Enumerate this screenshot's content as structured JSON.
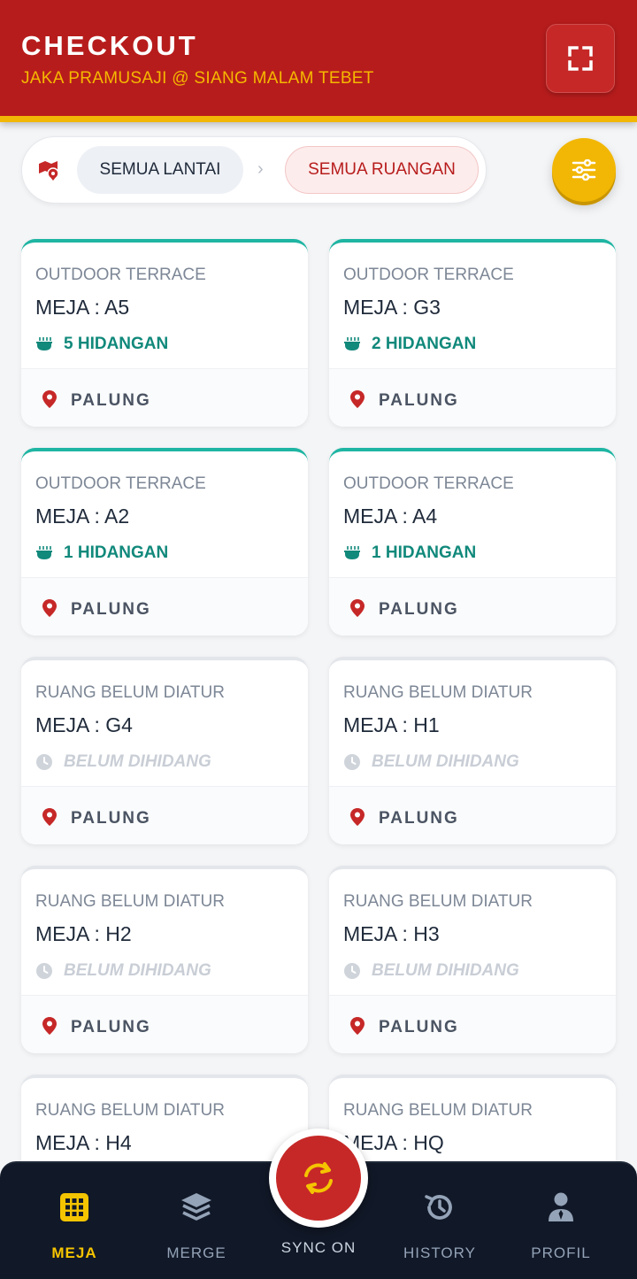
{
  "header": {
    "title": "CHECKOUT",
    "subtitle": "JAKA PRAMUSAJI @ SIANG MALAM  TEBET",
    "fullscreen_icon": "fullscreen-icon"
  },
  "filter": {
    "map_icon": "map-pin-icon",
    "floor_label": "SEMUA LANTAI",
    "separator": "›",
    "room_label": "SEMUA RUANGAN",
    "settings_icon": "sliders-icon"
  },
  "tables": [
    {
      "room": "OUTDOOR TERRACE",
      "table": "MEJA : A5",
      "status": "5 HIDANGAN",
      "served": true,
      "location": "PALUNG"
    },
    {
      "room": "OUTDOOR TERRACE",
      "table": "MEJA : G3",
      "status": "2 HIDANGAN",
      "served": true,
      "location": "PALUNG"
    },
    {
      "room": "OUTDOOR TERRACE",
      "table": "MEJA : A2",
      "status": "1 HIDANGAN",
      "served": true,
      "location": "PALUNG"
    },
    {
      "room": "OUTDOOR TERRACE",
      "table": "MEJA : A4",
      "status": "1 HIDANGAN",
      "served": true,
      "location": "PALUNG"
    },
    {
      "room": "RUANG BELUM DIATUR",
      "table": "MEJA : G4",
      "status": "BELUM DIHIDANG",
      "served": false,
      "location": "PALUNG"
    },
    {
      "room": "RUANG BELUM DIATUR",
      "table": "MEJA : H1",
      "status": "BELUM DIHIDANG",
      "served": false,
      "location": "PALUNG"
    },
    {
      "room": "RUANG BELUM DIATUR",
      "table": "MEJA : H2",
      "status": "BELUM DIHIDANG",
      "served": false,
      "location": "PALUNG"
    },
    {
      "room": "RUANG BELUM DIATUR",
      "table": "MEJA : H3",
      "status": "BELUM DIHIDANG",
      "served": false,
      "location": "PALUNG"
    },
    {
      "room": "RUANG BELUM DIATUR",
      "table": "MEJA : H4",
      "status": "",
      "served": false,
      "location": ""
    },
    {
      "room": "RUANG BELUM DIATUR",
      "table": "MEJA : HQ",
      "status": "",
      "served": false,
      "location": ""
    }
  ],
  "nav": {
    "items": [
      {
        "label": "MEJA",
        "icon": "grid-icon",
        "active": true
      },
      {
        "label": "MERGE",
        "icon": "layers-icon",
        "active": false
      },
      {
        "label": "SYNC ON",
        "icon": "sync-icon",
        "active": false
      },
      {
        "label": "HISTORY",
        "icon": "history-icon",
        "active": false
      },
      {
        "label": "PROFIL",
        "icon": "user-tie-icon",
        "active": false
      }
    ]
  },
  "colors": {
    "primary_red": "#b71c1c",
    "accent_yellow": "#f2b705",
    "served_teal": "#11897b",
    "nav_bg": "#111827"
  }
}
